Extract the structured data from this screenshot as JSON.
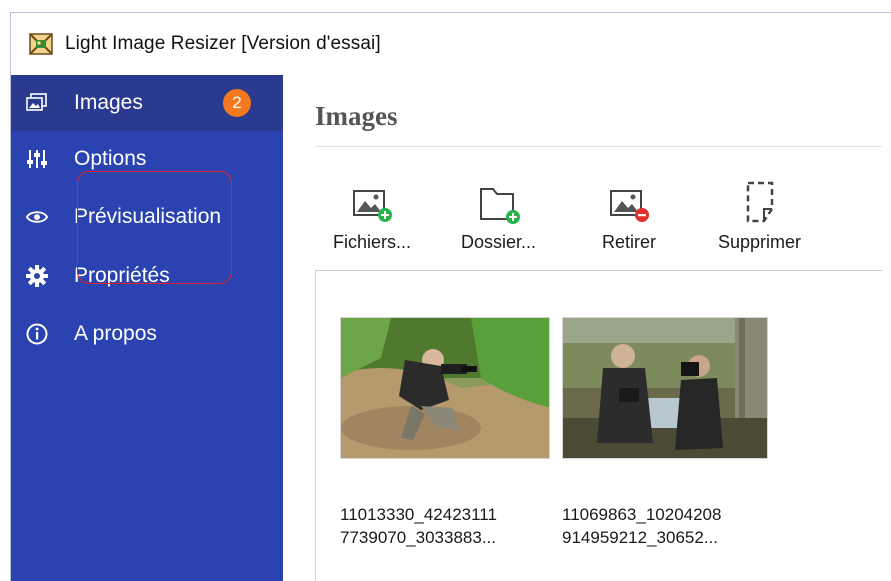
{
  "window": {
    "title": "Light Image Resizer  [Version d'essai]"
  },
  "sidebar": {
    "items": [
      {
        "id": "images",
        "label": "Images",
        "icon": "images-icon",
        "badge": "2",
        "active": true
      },
      {
        "id": "options",
        "label": "Options",
        "icon": "sliders-icon"
      },
      {
        "id": "preview",
        "label": "Prévisualisation",
        "icon": "eye-icon"
      },
      {
        "id": "properties",
        "label": "Propriétés",
        "icon": "gear-icon"
      },
      {
        "id": "about",
        "label": "A propos",
        "icon": "info-icon"
      }
    ]
  },
  "main": {
    "title": "Images",
    "toolbar": [
      {
        "id": "add-files",
        "label": "Fichiers...",
        "icon": "add-image-icon"
      },
      {
        "id": "add-folder",
        "label": "Dossier...",
        "icon": "add-folder-icon"
      },
      {
        "id": "remove",
        "label": "Retirer",
        "icon": "remove-image-icon"
      },
      {
        "id": "delete",
        "label": "Supprimer",
        "icon": "clear-list-icon"
      }
    ],
    "files": [
      {
        "line1": "11013330_42423111",
        "line2": "7739070_3033883..."
      },
      {
        "line1": "11069863_10204208",
        "line2": "914959212_30652..."
      }
    ]
  },
  "colors": {
    "sidebar": "#2b43b0",
    "sidebar_active": "#2a3a8e",
    "badge": "#f4781e",
    "add_accent": "#27b24a",
    "remove_accent": "#e2302d",
    "annotation": "#e0202a"
  }
}
